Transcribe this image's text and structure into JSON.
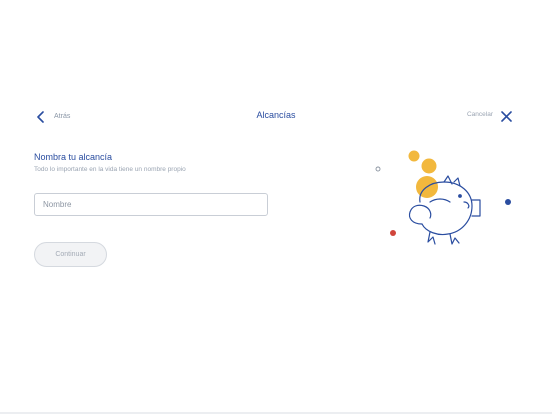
{
  "header": {
    "back_label": "Atrás",
    "title": "Alcancías",
    "cancel_label": "Cancelar"
  },
  "form": {
    "title": "Nombra tu alcancía",
    "subtitle": "Todo lo importante en la vida tiene un nombre propio",
    "name_input": {
      "placeholder": "Nombre",
      "value": ""
    },
    "continue_label": "Continuar",
    "continue_enabled": false
  },
  "colors": {
    "primary": "#2a4da0",
    "accent_yellow": "#f2b83d",
    "accent_red": "#d0453b",
    "muted_text": "#9aa4b2"
  },
  "icons": {
    "back": "chevron-left-icon",
    "close": "close-icon",
    "illustration": "piggy-bank-illustration"
  }
}
